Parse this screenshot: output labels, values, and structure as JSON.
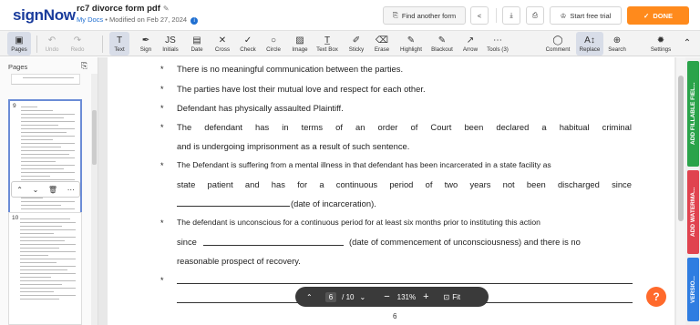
{
  "app": {
    "logo": "signNow",
    "doc_title": "rc7 divorce form pdf",
    "location": "My Docs",
    "modified": "Modified on Feb 27, 2024"
  },
  "topbar": {
    "find_label": "Find another form",
    "trial_label": "Start free trial",
    "done_label": "DONE"
  },
  "toolbar": {
    "items": [
      {
        "label": "Pages",
        "icon": "pages-icon"
      },
      {
        "label": "Undo",
        "icon": "undo-icon"
      },
      {
        "label": "Redo",
        "icon": "redo-icon"
      },
      {
        "label": "Text",
        "icon": "text-icon"
      },
      {
        "label": "Sign",
        "icon": "sign-icon"
      },
      {
        "label": "Initials",
        "icon": "initials-icon"
      },
      {
        "label": "Date",
        "icon": "date-icon"
      },
      {
        "label": "Cross",
        "icon": "cross-icon"
      },
      {
        "label": "Check",
        "icon": "check-icon"
      },
      {
        "label": "Circle",
        "icon": "circle-icon"
      },
      {
        "label": "Image",
        "icon": "image-icon"
      },
      {
        "label": "Text Box",
        "icon": "textbox-icon"
      },
      {
        "label": "Sticky",
        "icon": "sticky-icon"
      },
      {
        "label": "Erase",
        "icon": "erase-icon"
      },
      {
        "label": "Highlight",
        "icon": "highlight-icon"
      },
      {
        "label": "Blackout",
        "icon": "blackout-icon"
      },
      {
        "label": "Arrow",
        "icon": "arrow-icon"
      },
      {
        "label": "Tools (3)",
        "icon": "more-icon"
      },
      {
        "label": "Comment",
        "icon": "comment-icon"
      },
      {
        "label": "Replace",
        "icon": "replace-icon"
      },
      {
        "label": "Search",
        "icon": "search-icon"
      },
      {
        "label": "Settings",
        "icon": "settings-icon"
      }
    ]
  },
  "sidebar": {
    "title": "Pages",
    "pages": [
      "9",
      "10"
    ]
  },
  "document": {
    "bullets": [
      "There is no meaningful communication between the parties.",
      "The parties have lost their mutual love and respect for each other.",
      "Defendant has physically assaulted Plaintiff."
    ],
    "item4_line1": [
      "The",
      "defendant",
      "has",
      "in",
      "terms",
      "of",
      "an",
      "order",
      "of",
      "Court",
      "been",
      "declared",
      "a",
      "habitual",
      "criminal"
    ],
    "item4_line2": "and is undergoing imprisonment as a result of such sentence.",
    "item5_line1": "The Defendant is suffering from a mental illness in that defendant has been incarcerated in a state facility as",
    "item5_line2": [
      "state",
      "patient",
      "and",
      "has",
      "for",
      "a",
      "continuous",
      "period",
      "of",
      "two",
      "years",
      "not",
      "been",
      "discharged",
      "since"
    ],
    "item5_line3": "(date of incarceration).",
    "item6_line1": "The defendant is unconscious for a continuous period for at least six months prior to instituting this action",
    "item6_line2_start": "since",
    "item6_line2_end": "(date of commencement of unconsciousness) and there is no",
    "item6_line3": "reasonable prospect of recovery.",
    "page_number": "6"
  },
  "pager": {
    "current_page": "6",
    "total": "/ 10",
    "zoom": "131%",
    "fit_label": "Fit"
  },
  "right_tabs": {
    "fillable": "ADD FILLABLE FIEL...",
    "watermark": "ADD WATERMA...",
    "version": "VERSIO..."
  },
  "colors": {
    "brand": "#1a3c9c",
    "done": "#ff8a1c",
    "green_tab": "#2aa34a",
    "red_tab": "#e0434f",
    "blue_tab": "#2f7de1"
  }
}
